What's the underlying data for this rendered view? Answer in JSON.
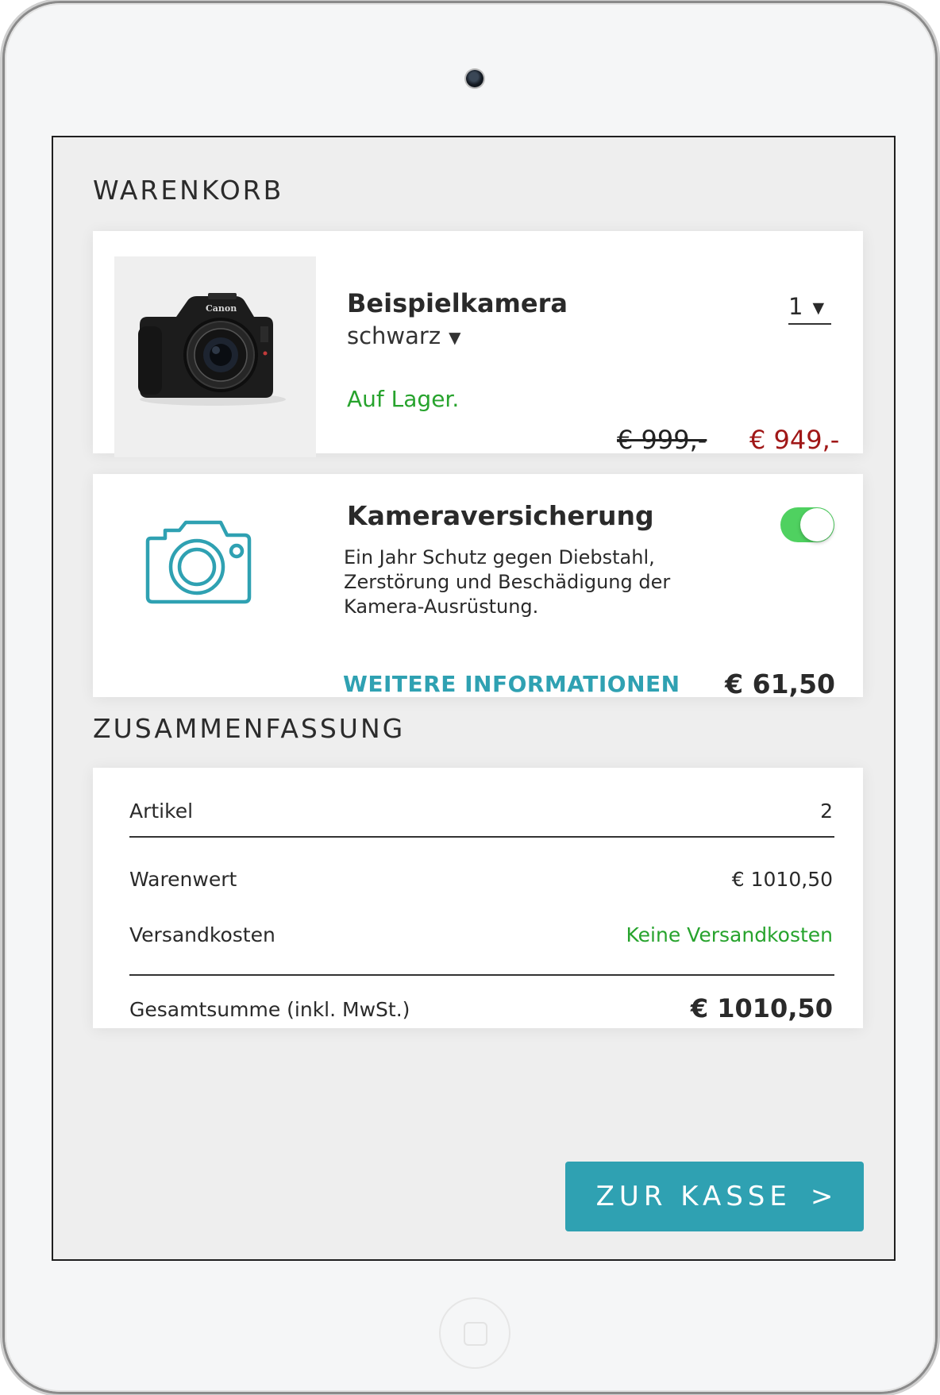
{
  "cart": {
    "title": "WARENKORB",
    "product": {
      "name": "Beispielkamera",
      "variant": "schwarz",
      "stock": "Auf Lager.",
      "quantity": "1",
      "old_price": "€ 999,-",
      "price": "€ 949,-",
      "image_icon": "camera-photo"
    },
    "insurance": {
      "title": "Kameraversicherung",
      "description": "Ein Jahr Schutz gegen Diebstahl, Zerstörung und Beschädigung der Kamera-Ausrüstung.",
      "more_info": "WEITERE INFORMATIONEN",
      "price": "€ 61,50",
      "toggle_on": true,
      "icon": "camera-outline-icon"
    }
  },
  "summary": {
    "title": "ZUSAMMENFASSUNG",
    "items_label": "Artikel",
    "items_value": "2",
    "goods_label": "Warenwert",
    "goods_value": "€ 1010,50",
    "shipping_label": "Versandkosten",
    "shipping_value": "Keine Versandkosten",
    "total_label": "Gesamtsumme (inkl. MwSt.)",
    "total_value": "€ 1010,50"
  },
  "checkout": {
    "label": "ZUR KASSE",
    "icon": "chevron-right-icon"
  },
  "colors": {
    "accent": "#2fa1b2",
    "in_stock": "#27a32d",
    "sale_price": "#a01717",
    "toggle": "#4fd160"
  }
}
